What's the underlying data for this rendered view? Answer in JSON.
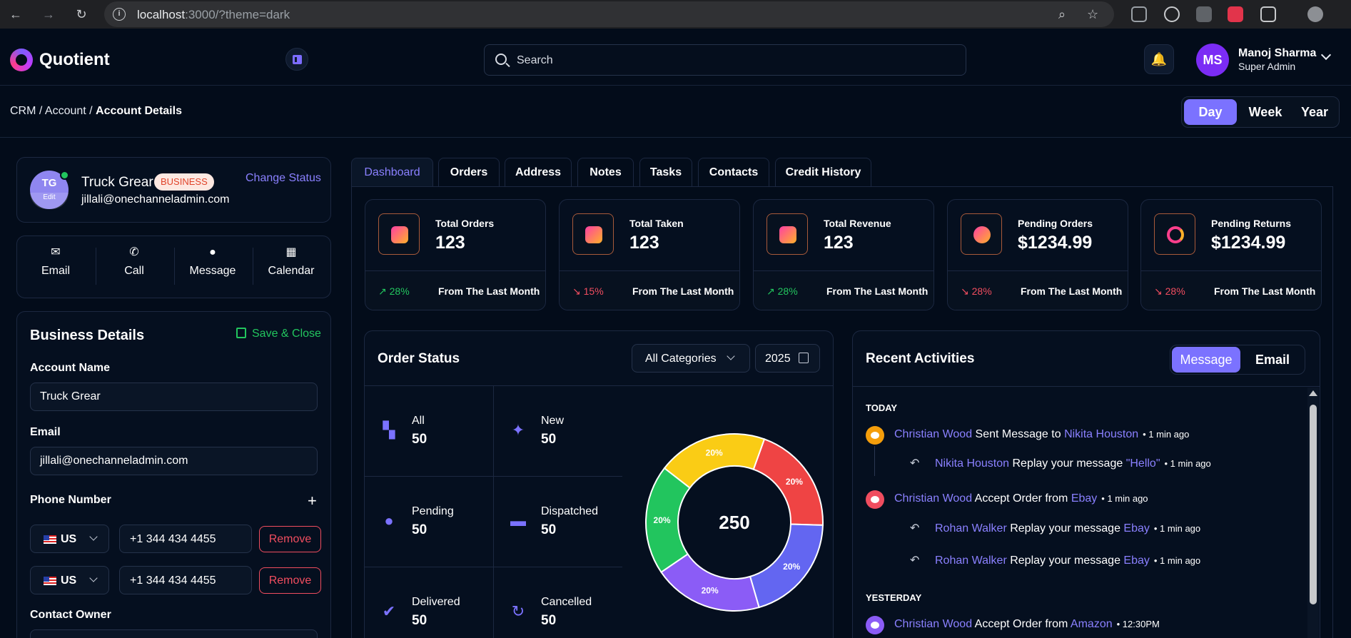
{
  "browser": {
    "url_host": "localhost",
    "url_rest": ":3000/?theme=dark"
  },
  "app": {
    "name": "Quotient",
    "search_placeholder": "Search",
    "user": {
      "initials": "MS",
      "name": "Manoj Sharma",
      "role": "Super Admin"
    }
  },
  "breadcrumb": {
    "items": [
      "CRM",
      "Account"
    ],
    "current": "Account Details",
    "sep": " / "
  },
  "range": {
    "options": [
      "Day",
      "Week",
      "Year"
    ],
    "active": "Day"
  },
  "profile": {
    "initials": "TG",
    "edit": "Edit",
    "name": "Truck Grear",
    "badge": "BUSINESS",
    "email": "jillali@onechanneladmin.com",
    "change_status": "Change Status"
  },
  "quick_actions": [
    {
      "label": "Email",
      "icon": "mail-icon"
    },
    {
      "label": "Call",
      "icon": "phone-icon"
    },
    {
      "label": "Message",
      "icon": "chat-icon"
    },
    {
      "label": "Calendar",
      "icon": "calendar-icon"
    }
  ],
  "business": {
    "title": "Business Details",
    "save_close": "Save & Close",
    "account_name_label": "Account Name",
    "account_name_value": "Truck Grear",
    "email_label": "Email",
    "email_value": "jillali@onechanneladmin.com",
    "phone_label": "Phone Number",
    "add": "+",
    "phones": [
      {
        "country": "US",
        "number": "+1 344 434 4455",
        "remove": "Remove"
      },
      {
        "country": "US",
        "number": "+1 344 434 4455",
        "remove": "Remove"
      }
    ],
    "owner_label": "Contact Owner"
  },
  "tabs": [
    "Dashboard",
    "Orders",
    "Address",
    "Notes",
    "Tasks",
    "Contacts",
    "Credit History"
  ],
  "active_tab": "Dashboard",
  "stats": [
    {
      "title": "Total Orders",
      "value": "123",
      "trend": "28%",
      "dir": "up",
      "foot": "From The Last Month",
      "icon": "bag-icon"
    },
    {
      "title": "Total Taken",
      "value": "123",
      "trend": "15%",
      "dir": "down",
      "foot": "From The Last Month",
      "icon": "hand-heart-icon"
    },
    {
      "title": "Total Revenue",
      "value": "123",
      "trend": "28%",
      "dir": "up",
      "foot": "From The Last Month",
      "icon": "coins-icon"
    },
    {
      "title": "Pending Orders",
      "value": "$1234.99",
      "trend": "28%",
      "dir": "down",
      "foot": "From The Last Month",
      "icon": "stopwatch-icon"
    },
    {
      "title": "Pending Returns",
      "value": "$1234.99",
      "trend": "28%",
      "dir": "down",
      "foot": "From The Last Month",
      "icon": "spinner-icon"
    }
  ],
  "order_status": {
    "title": "Order Status",
    "category": "All Categories",
    "year": "2025",
    "cells": [
      {
        "label": "All",
        "value": "50",
        "icon": "grid-icon"
      },
      {
        "label": "New",
        "value": "50",
        "icon": "party-icon"
      },
      {
        "label": "Pending",
        "value": "50",
        "icon": "timer-icon"
      },
      {
        "label": "Dispatched",
        "value": "50",
        "icon": "truck-icon"
      },
      {
        "label": "Delivered",
        "value": "50",
        "icon": "verified-icon"
      },
      {
        "label": "Cancelled",
        "value": "50",
        "icon": "cancel-icon"
      }
    ],
    "total": "250"
  },
  "chart_data": {
    "type": "pie",
    "center_label": "250",
    "slices": [
      {
        "label": "20%",
        "value": 20,
        "color": "#ef4444"
      },
      {
        "label": "20%",
        "value": 20,
        "color": "#6366f1"
      },
      {
        "label": "20%",
        "value": 20,
        "color": "#8b5cf6"
      },
      {
        "label": "20%",
        "value": 20,
        "color": "#22c55e"
      },
      {
        "label": "20%",
        "value": 20,
        "color": "#facc15"
      }
    ]
  },
  "activities": {
    "title": "Recent Activities",
    "toggle": [
      "Message",
      "Email"
    ],
    "today": "TODAY",
    "yesterday": "YESTERDAY",
    "items": [
      {
        "who": "Christian Wood",
        "mid": " Sent Message to ",
        "target": "Nikita Houston",
        "time": "• 1 min ago"
      },
      {
        "who": "Nikita Houston",
        "mid": " Replay your message ",
        "target": "\"Hello\"",
        "time": "• 1 min ago"
      },
      {
        "who": "Christian Wood",
        "mid": " Accept Order from ",
        "target": "Ebay",
        "time": "• 1 min ago"
      },
      {
        "who": "Rohan Walker",
        "mid": " Replay your message ",
        "target": "Ebay",
        "time": "• 1 min ago"
      },
      {
        "who": "Rohan Walker",
        "mid": " Replay your message ",
        "target": "Ebay",
        "time": "• 1 min ago"
      },
      {
        "who": "Christian Wood",
        "mid": " Accept Order from ",
        "target": "Amazon",
        "time": "• 12:30PM"
      }
    ]
  }
}
